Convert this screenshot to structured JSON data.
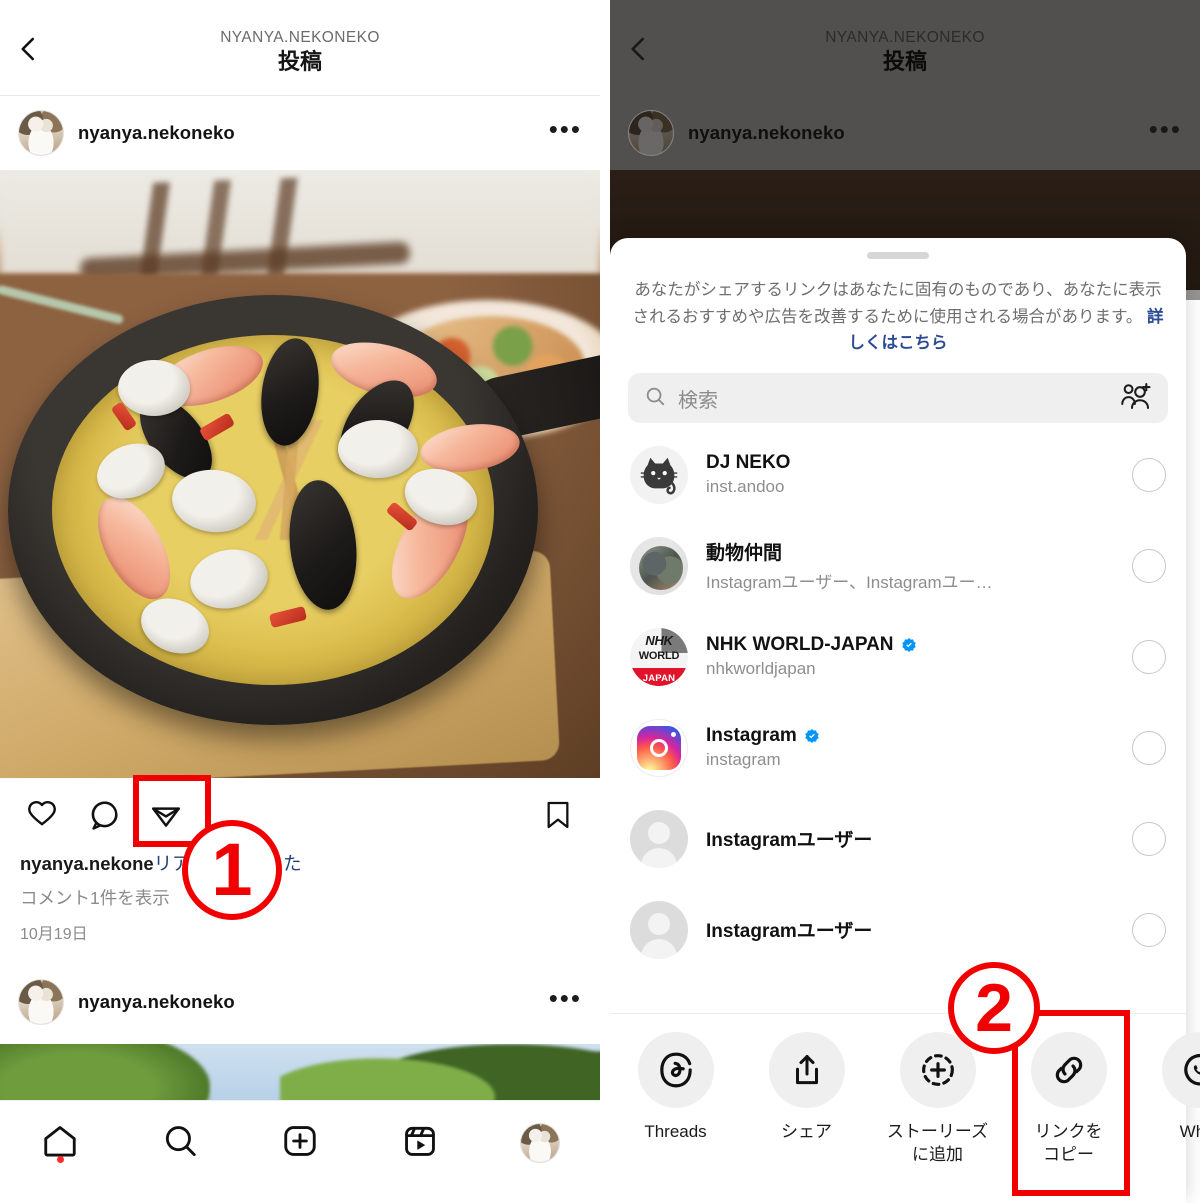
{
  "left_panel": {
    "header": {
      "subtitle": "NYANYA.NEKONEKO",
      "title": "投稿",
      "back_icon": "back-chevron-icon"
    },
    "post": {
      "username": "nyanya.nekoneko",
      "more_icon": "more-options-icon",
      "photo_alt": "seafood-paella-in-skillet",
      "actions": {
        "like": "heart-icon",
        "comment": "comment-icon",
        "share": "share-paper-plane-icon",
        "bookmark": "bookmark-icon"
      },
      "caption_user": "nyanya.nekone",
      "caption_text": "リアを家で作った",
      "comments_link": "コメント1件を表示",
      "date": "10月19日"
    },
    "post2": {
      "username": "nyanya.nekoneko",
      "more_icon": "more-options-icon",
      "photo_alt": "sky-and-trees"
    },
    "tabbar": [
      {
        "name": "home",
        "icon": "home-icon",
        "badge": true
      },
      {
        "name": "search",
        "icon": "search-icon",
        "badge": false
      },
      {
        "name": "create",
        "icon": "plus-square-icon",
        "badge": false
      },
      {
        "name": "reels",
        "icon": "reels-icon",
        "badge": false
      },
      {
        "name": "profile",
        "icon": "profile-avatar-icon",
        "badge": false
      }
    ]
  },
  "right_panel": {
    "header": {
      "subtitle": "NYANYA.NEKONEKO",
      "title": "投稿",
      "back_icon": "back-chevron-icon"
    },
    "post": {
      "username": "nyanya.nekoneko",
      "more_icon": "more-options-icon"
    },
    "share_sheet": {
      "notice_text": "あなたがシェアするリンクはあなたに固有のものであり、あなたに表示されるおすすめや広告を改善するために使用される場合があります。",
      "notice_link": "詳しくはこちら",
      "search_placeholder": "検索",
      "search_icon": "search-icon",
      "add_people_icon": "add-people-icon",
      "contacts": [
        {
          "name": "DJ NEKO",
          "sub": "inst.andoo",
          "verified": false,
          "avatar": "cat-illustration-avatar"
        },
        {
          "name": "動物仲間",
          "sub": "Instagramユーザー、Instagramユー…",
          "verified": false,
          "avatar": "group-dog-avatar"
        },
        {
          "name": "NHK WORLD-JAPAN",
          "sub": "nhkworldjapan",
          "verified": true,
          "avatar": "nhk-world-japan-logo"
        },
        {
          "name": "Instagram",
          "sub": "instagram",
          "verified": true,
          "avatar": "instagram-logo"
        },
        {
          "name": "Instagramユーザー",
          "sub": "",
          "verified": false,
          "avatar": "default-person-avatar"
        },
        {
          "name": "Instagramユーザー",
          "sub": "",
          "verified": false,
          "avatar": "default-person-avatar"
        }
      ],
      "actions": [
        {
          "label": "Threads",
          "icon": "threads-icon"
        },
        {
          "label": "シェア",
          "icon": "share-upload-icon"
        },
        {
          "label": "ストーリーズ\nに追加",
          "icon": "add-to-story-icon"
        },
        {
          "label": "リンクを\nコピー",
          "icon": "link-copy-icon"
        },
        {
          "label": "What",
          "icon": "whatsapp-icon"
        }
      ]
    }
  },
  "annotations": [
    {
      "number": "①",
      "target": "share-paper-plane-icon"
    },
    {
      "number": "②",
      "target": "copy-link-action"
    }
  ],
  "colors": {
    "accent_red": "#f00000",
    "link_blue": "#2b4b94",
    "verified_blue": "#0095f6"
  }
}
